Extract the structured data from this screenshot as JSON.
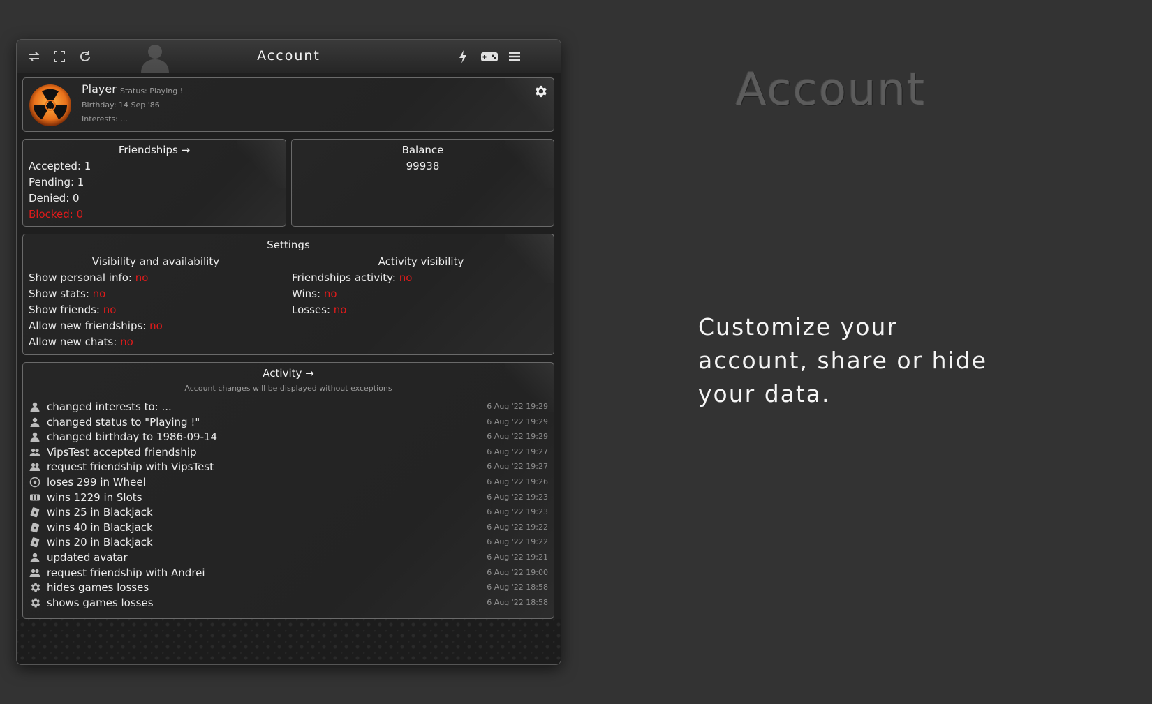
{
  "window": {
    "title": "Account",
    "toolbar_left": [
      "swap-icon",
      "fullscreen-icon",
      "refresh-icon"
    ],
    "toolbar_right": [
      "lightning-icon",
      "gamepad-icon",
      "menu-icon"
    ]
  },
  "profile": {
    "name": "Player",
    "status": "Status: Playing !",
    "birthday": "Birthday: 14 Sep '86",
    "interests": "Interests: ..."
  },
  "friendships": {
    "title": "Friendships →",
    "accepted": "Accepted: 1",
    "pending": "Pending: 1",
    "denied": "Denied: 0",
    "blocked": "Blocked: 0"
  },
  "balance": {
    "title": "Balance",
    "value": "99938"
  },
  "settings": {
    "title": "Settings",
    "visibility_title": "Visibility and availability",
    "activity_title": "Activity visibility",
    "visibility": [
      {
        "label": "Show personal info:",
        "value": "no"
      },
      {
        "label": "Show stats:",
        "value": "no"
      },
      {
        "label": "Show friends:",
        "value": "no"
      },
      {
        "label": "Allow new friendships:",
        "value": "no"
      },
      {
        "label": "Allow new chats:",
        "value": "no"
      }
    ],
    "activity": [
      {
        "label": "Friendships activity:",
        "value": "no"
      },
      {
        "label": "Wins:",
        "value": "no"
      },
      {
        "label": "Losses:",
        "value": "no"
      }
    ]
  },
  "activity": {
    "title": "Activity →",
    "subtitle": "Account changes will be displayed without exceptions",
    "items": [
      {
        "icon": "user-icon",
        "text": "changed interests to: ...",
        "time": "6 Aug '22 19:29"
      },
      {
        "icon": "user-icon",
        "text": "changed status to \"Playing !\"",
        "time": "6 Aug '22 19:29"
      },
      {
        "icon": "user-icon",
        "text": "changed birthday to 1986-09-14",
        "time": "6 Aug '22 19:29"
      },
      {
        "icon": "users-icon",
        "text": "VipsTest accepted friendship",
        "time": "6 Aug '22 19:27"
      },
      {
        "icon": "users-icon",
        "text": "request friendship with VipsTest",
        "time": "6 Aug '22 19:27"
      },
      {
        "icon": "wheel-icon",
        "text": "loses 299 in Wheel",
        "time": "6 Aug '22 19:26"
      },
      {
        "icon": "slots-icon",
        "text": "wins 1229 in Slots",
        "time": "6 Aug '22 19:23"
      },
      {
        "icon": "cards-icon",
        "text": "wins 25 in Blackjack",
        "time": "6 Aug '22 19:23"
      },
      {
        "icon": "cards-icon",
        "text": "wins 40 in Blackjack",
        "time": "6 Aug '22 19:22"
      },
      {
        "icon": "cards-icon",
        "text": "wins 20 in Blackjack",
        "time": "6 Aug '22 19:22"
      },
      {
        "icon": "user-icon",
        "text": "updated avatar",
        "time": "6 Aug '22 19:21"
      },
      {
        "icon": "users-icon",
        "text": "request friendship with Andrei",
        "time": "6 Aug '22 19:00"
      },
      {
        "icon": "gear-icon",
        "text": "hides games losses",
        "time": "6 Aug '22 18:58"
      },
      {
        "icon": "gear-icon",
        "text": "shows games losses",
        "time": "6 Aug '22 18:58"
      }
    ]
  },
  "side": {
    "title": "Account",
    "text": "Customize your account, share or hide your data."
  },
  "colors": {
    "background": "#333333",
    "panel": "#232323",
    "accent_red": "#e01b1b",
    "avatar_orange": "#e8701a"
  }
}
